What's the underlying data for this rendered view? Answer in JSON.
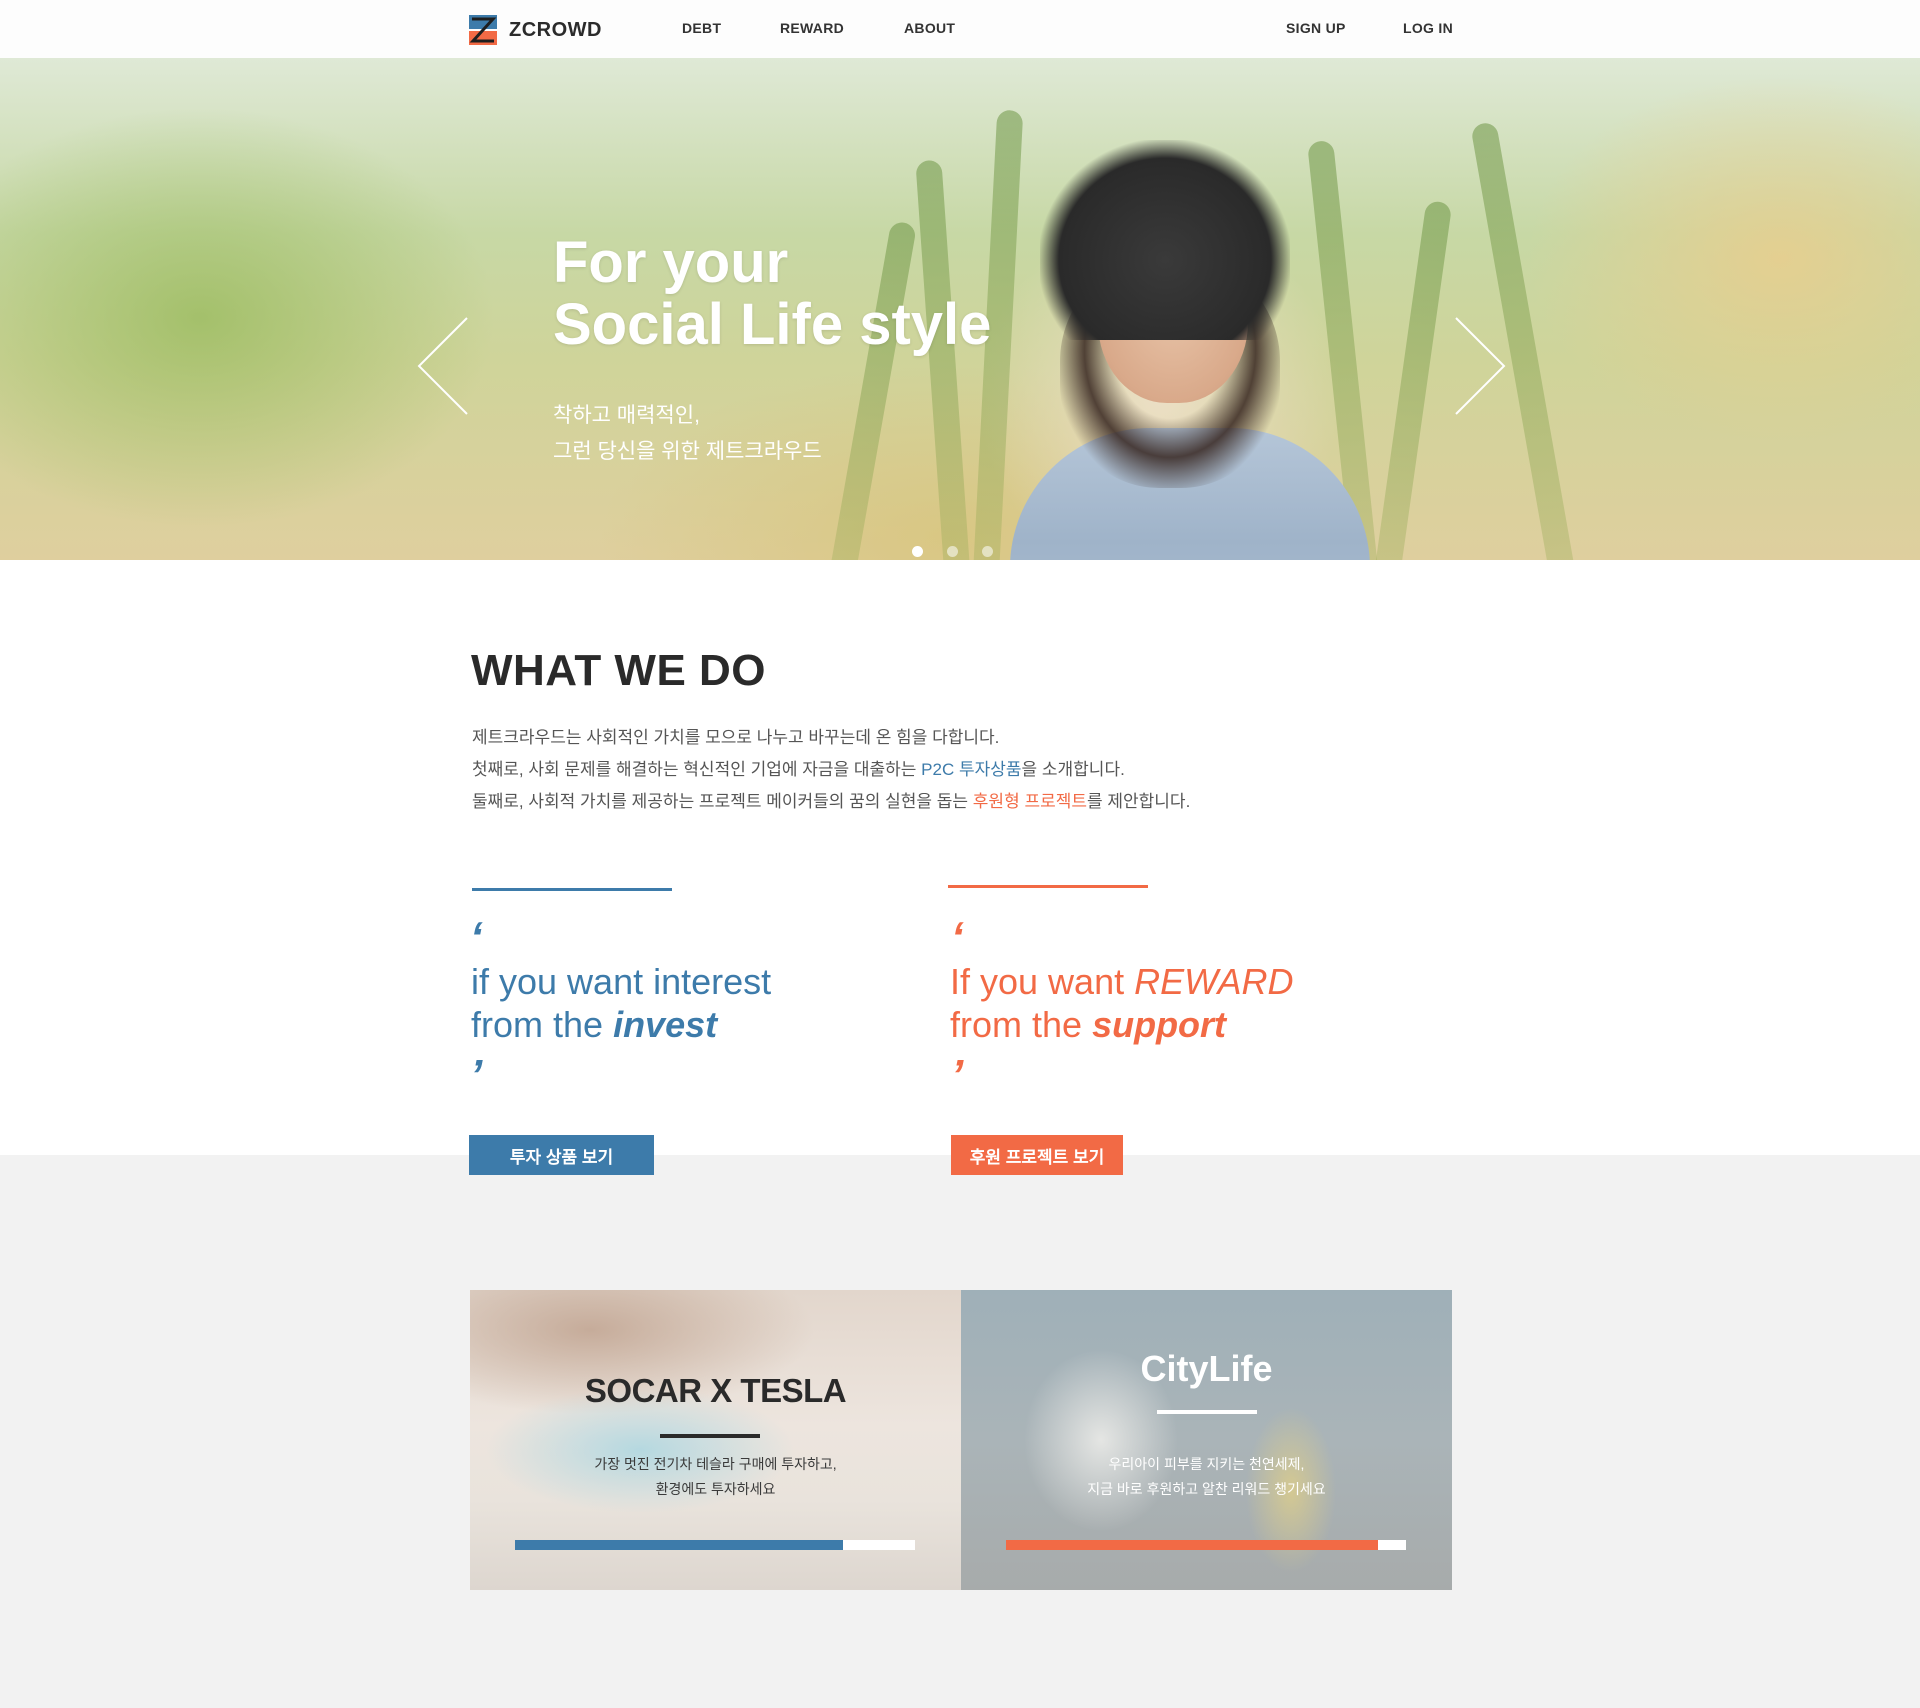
{
  "header": {
    "brand": "ZCROWD",
    "nav": [
      "DEBT",
      "REWARD",
      "ABOUT"
    ],
    "sign_up": "SIGN UP",
    "log_in": "LOG IN"
  },
  "hero": {
    "title_line1": "For your",
    "title_line2": "Social Life style",
    "sub_line1": "착하고 매력적인,",
    "sub_line2": "그런 당신을 위한 제트크라우드",
    "active_slide": 1,
    "slide_count": 3
  },
  "what_we_do": {
    "title": "WHAT WE DO",
    "line1": "제트크라우드는 사회적인 가치를 모으로 나누고 바꾸는데 온 힘을 다합니다.",
    "line2_pre": "첫째로, 사회 문제를 해결하는 혁신적인 기업에 자금을 대출하는 ",
    "line2_highlight": "P2C 투자상품",
    "line2_post": "을 소개합니다.",
    "line3_pre": "둘째로, 사회적 가치를 제공하는 프로젝트 메이커들의 꿈의 실현을 돕는 ",
    "line3_highlight": "후원형 프로젝트",
    "line3_post": "를 제안합니다."
  },
  "invest_column": {
    "open_quote": "‘",
    "close_quote": "’",
    "line1": "if you want interest",
    "line2_pre": "from the ",
    "line2_em": "invest",
    "button": "투자 상품 보기"
  },
  "reward_column": {
    "open_quote": "‘",
    "close_quote": "’",
    "line1_pre": "If you want ",
    "line1_em": "REWARD",
    "line2_pre": "from the ",
    "line2_em": "support",
    "button": "후원 프로젝트 보기"
  },
  "cards": [
    {
      "title": "SOCAR X TESLA",
      "desc_line1": "가장 멋진 전기차 테슬라 구매에 투자하고,",
      "desc_line2": "환경에도 투자하세요",
      "progress": 0.82
    },
    {
      "title": "CityLife",
      "desc_line1": "우리아이 피부를 지키는 천연세제,",
      "desc_line2": "지금 바로 후원하고 알찬 리워드 챙기세요",
      "progress": 0.93
    }
  ],
  "colors": {
    "blue": "#3d7baa",
    "orange": "#f26a45",
    "dark": "#2a2a2a",
    "light_bg": "#f2f2f2"
  },
  "icons": [
    "zcrowd-logo-icon",
    "chevron-left-icon",
    "chevron-right-icon"
  ]
}
